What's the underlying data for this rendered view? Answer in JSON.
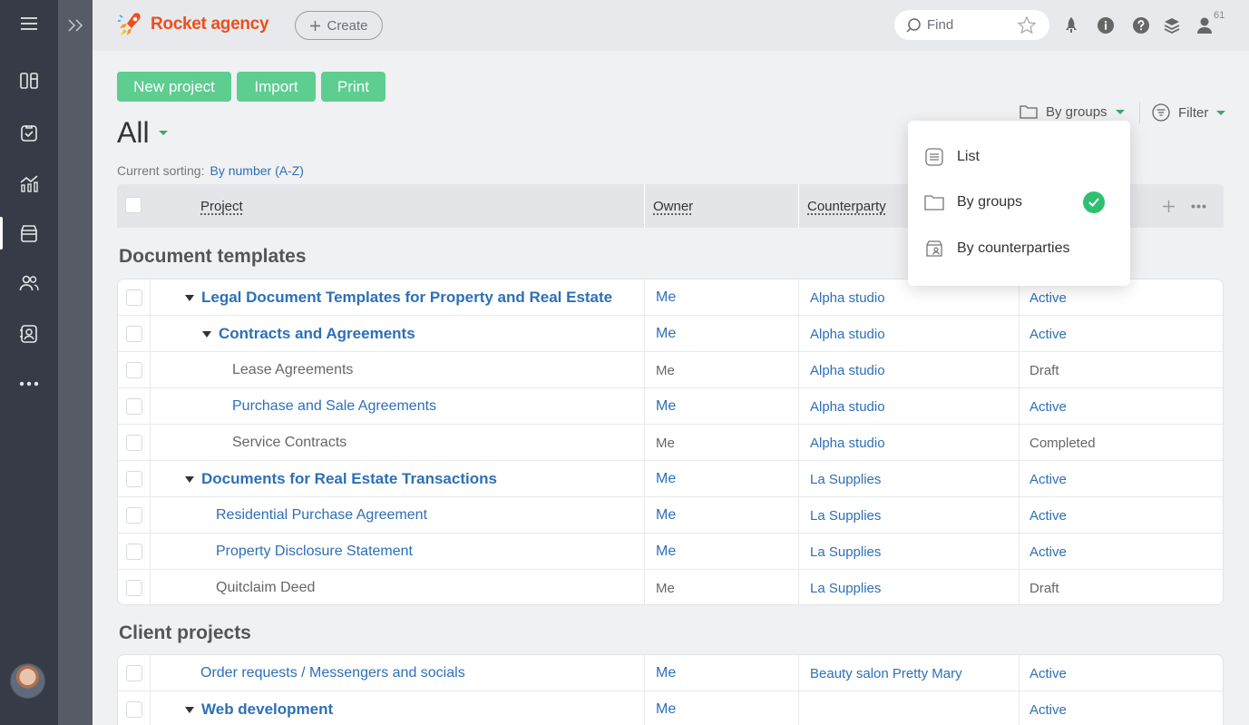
{
  "app": {
    "name": "Rocket agency"
  },
  "topbar": {
    "create_label": "Create",
    "search_placeholder": "Find",
    "profile_count": "61"
  },
  "actions": {
    "new_project": "New project",
    "import": "Import",
    "print": "Print"
  },
  "view": {
    "title": "All",
    "view_mode": "By groups",
    "filter_label": "Filter"
  },
  "sorting": {
    "label": "Current sorting:",
    "value": "By number (A-Z)"
  },
  "table": {
    "columns": {
      "project": "Project",
      "owner": "Owner",
      "counterparty": "Counterparty"
    }
  },
  "dropdown": {
    "items": [
      {
        "label": "List",
        "icon": "list-icon",
        "selected": false
      },
      {
        "label": "By groups",
        "icon": "folder-icon",
        "selected": true
      },
      {
        "label": "By counterparties",
        "icon": "counterparties-icon",
        "selected": false
      }
    ]
  },
  "groups": [
    {
      "title": "Document templates",
      "rows": [
        {
          "project": "Legal Document Templates for Property and Real Estate",
          "owner": "Me",
          "counterparty": "Alpha studio",
          "status": "Active"
        },
        {
          "project": "Contracts and Agreements",
          "owner": "Me",
          "counterparty": "Alpha studio",
          "status": "Active"
        },
        {
          "project": "Lease Agreements",
          "owner": "Me",
          "counterparty": "Alpha studio",
          "status": "Draft"
        },
        {
          "project": "Purchase and Sale Agreements",
          "owner": "Me",
          "counterparty": "Alpha studio",
          "status": "Active"
        },
        {
          "project": "Service Contracts",
          "owner": "Me",
          "counterparty": "Alpha studio",
          "status": "Completed"
        },
        {
          "project": "Documents for Real Estate Transactions",
          "owner": "Me",
          "counterparty": "La Supplies",
          "status": "Active"
        },
        {
          "project": "Residential Purchase Agreement",
          "owner": "Me",
          "counterparty": "La Supplies",
          "status": "Active"
        },
        {
          "project": "Property Disclosure Statement",
          "owner": "Me",
          "counterparty": "La Supplies",
          "status": "Active"
        },
        {
          "project": "Quitclaim Deed",
          "owner": "Me",
          "counterparty": "La Supplies",
          "status": "Draft"
        }
      ]
    },
    {
      "title": "Client projects",
      "rows": [
        {
          "project": "Order requests / Messengers and socials",
          "owner": "Me",
          "counterparty": "Beauty salon Pretty Mary",
          "status": "Active"
        },
        {
          "project": "Web development",
          "owner": "Me",
          "counterparty": "",
          "status": "Active"
        }
      ]
    }
  ],
  "colors": {
    "accent_green": "#5dcd90",
    "link_blue": "#2d6fb7",
    "brand_orange": "#ec4e1d",
    "rail": "#363b47"
  }
}
